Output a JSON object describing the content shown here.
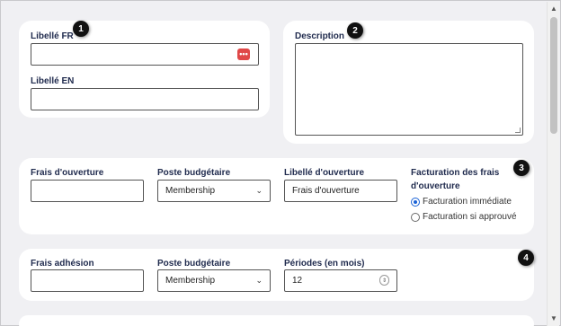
{
  "section1": {
    "libelle_fr_label": "Libellé FR",
    "libelle_fr_value": "",
    "libelle_en_label": "Libellé EN",
    "libelle_en_value": "",
    "badge": "1"
  },
  "section2": {
    "description_label": "Description",
    "description_value": "",
    "badge": "2"
  },
  "section3": {
    "frais_label": "Frais d'ouverture",
    "frais_value": "",
    "poste_label": "Poste budgétaire",
    "poste_value": "Membership",
    "libelle_ouverture_label": "Libellé d'ouverture",
    "libelle_ouverture_value": "Frais d'ouverture",
    "facturation_label_line1": "Facturation des frais",
    "facturation_label_line2": "d'ouverture",
    "options": [
      "Facturation immédiate",
      "Facturation si approuvé"
    ],
    "selected_option": "Facturation immédiate",
    "badge": "3"
  },
  "section4": {
    "adhesion_label": "Frais adhésion",
    "adhesion_value": "",
    "poste_label": "Poste budgétaire",
    "poste_value": "Membership",
    "periodes_label": "Périodes (en mois)",
    "periodes_value": "12",
    "badge": "4"
  },
  "colors": {
    "label": "#1f2a4d",
    "background": "#f0f0f3",
    "card": "#ffffff",
    "radio_accent": "#1a62d6",
    "dots_icon": "#e04848"
  }
}
